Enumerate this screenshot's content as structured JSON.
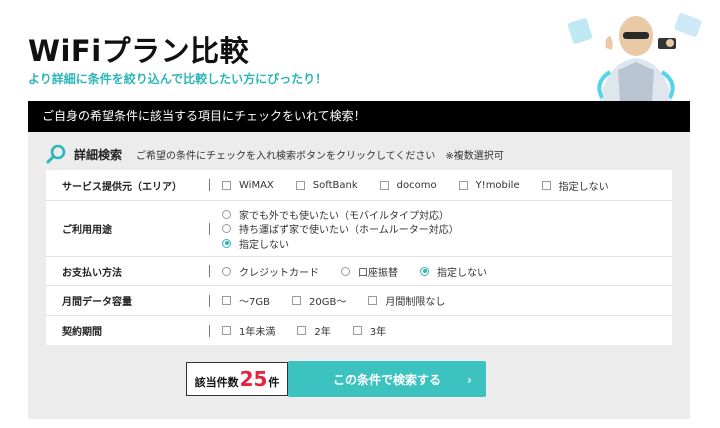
{
  "header": {
    "title": "WiFiプラン比較",
    "subtitle": "より詳細に条件を絞り込んで比較したい方にぴったり！"
  },
  "banner": {
    "text": "ご自身の希望条件に該当する項目にチェックをいれて検索！"
  },
  "search": {
    "label": "詳細検索",
    "description": "ご希望の条件にチェックを入れ検索ボタンをクリックしてください　※複数選択可"
  },
  "rows": {
    "provider": {
      "label": "サービス提供元（エリア）",
      "options": [
        {
          "label": "WiMAX",
          "checked": false
        },
        {
          "label": "SoftBank",
          "checked": false
        },
        {
          "label": "docomo",
          "checked": false
        },
        {
          "label": "Y!mobile",
          "checked": false
        },
        {
          "label": "指定しない",
          "checked": false
        }
      ]
    },
    "usage": {
      "label": "ご利用用途",
      "options": [
        {
          "label": "家でも外でも使いたい（モバイルタイプ対応）",
          "selected": false
        },
        {
          "label": "持ち運ばず家で使いたい（ホームルーター対応）",
          "selected": false
        },
        {
          "label": "指定しない",
          "selected": true
        }
      ]
    },
    "payment": {
      "label": "お支払い方法",
      "options": [
        {
          "label": "クレジットカード",
          "selected": false
        },
        {
          "label": "口座振替",
          "selected": false
        },
        {
          "label": "指定しない",
          "selected": true
        }
      ]
    },
    "data": {
      "label": "月間データ容量",
      "options": [
        {
          "label": "～7GB",
          "checked": false
        },
        {
          "label": "20GB～",
          "checked": false
        },
        {
          "label": "月間制限なし",
          "checked": false
        }
      ]
    },
    "term": {
      "label": "契約期間",
      "options": [
        {
          "label": "1年未満",
          "checked": false
        },
        {
          "label": "2年",
          "checked": false
        },
        {
          "label": "3年",
          "checked": false
        }
      ]
    }
  },
  "result": {
    "prefix": "該当件数",
    "count": "25",
    "suffix": "件"
  },
  "button": {
    "label": "この条件で検索する",
    "chevron": "›"
  },
  "colors": {
    "accent": "#3cc3c0",
    "count": "#e5233b",
    "banner": "#000000",
    "panel": "#ececec"
  }
}
